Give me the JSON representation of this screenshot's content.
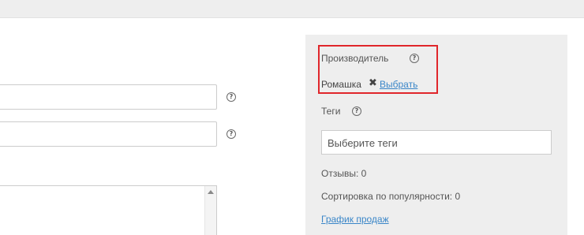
{
  "form": {
    "help_glyph": "?"
  },
  "side_panel": {
    "manufacturer": {
      "label": "Производитель",
      "value": "Ромашка",
      "remove_glyph": "✖",
      "select_link": "Выбрать"
    },
    "tags": {
      "label": "Теги",
      "placeholder": "Выберите теги"
    },
    "reviews": "Отзывы: 0",
    "popularity_sort": "Сортировка по популярности: 0",
    "sales_chart_link": "График продаж"
  },
  "colors": {
    "highlight": "#e0262b",
    "link": "#3a86c8",
    "panel_bg": "#eeeeee"
  },
  "icons": [
    "help-icon",
    "remove-icon",
    "scroll-up-arrow-icon"
  ]
}
